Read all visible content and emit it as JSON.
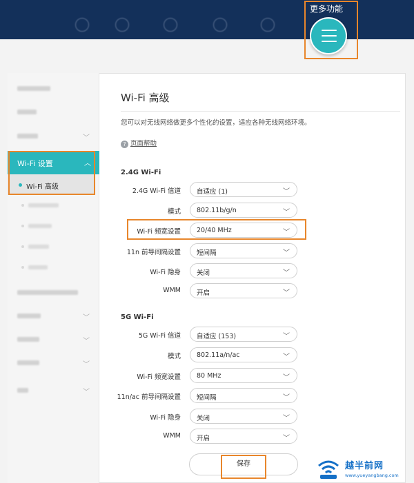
{
  "top_nav": {
    "more_label": "更多功能"
  },
  "sidebar": {
    "active_label": "Wi-Fi 设置",
    "active_sub_label": "Wi-Fi 高级"
  },
  "content": {
    "title": "Wi-Fi 高级",
    "description": "您可以对无线网络做更多个性化的设置，适应各种无线网络环境。",
    "help_link": "页面帮助",
    "section_24": {
      "heading": "2.4G Wi-Fi",
      "rows": [
        {
          "label": "2.4G Wi-Fi 信道",
          "value": "自适应 (1)"
        },
        {
          "label": "模式",
          "value": "802.11b/g/n"
        },
        {
          "label": "Wi-Fi 频宽设置",
          "value": "20/40 MHz"
        },
        {
          "label": "11n 前导间隔设置",
          "value": "短间隔"
        },
        {
          "label": "Wi-Fi 隐身",
          "value": "关闭"
        },
        {
          "label": "WMM",
          "value": "开启"
        }
      ]
    },
    "section_5": {
      "heading": "5G Wi-Fi",
      "rows": [
        {
          "label": "5G Wi-Fi 信道",
          "value": "自适应 (153)"
        },
        {
          "label": "模式",
          "value": "802.11a/n/ac"
        },
        {
          "label": "Wi-Fi 频宽设置",
          "value": "80 MHz"
        },
        {
          "label": "11n/ac 前导间隔设置",
          "value": "短间隔"
        },
        {
          "label": "Wi-Fi 隐身",
          "value": "关闭"
        },
        {
          "label": "WMM",
          "value": "开启"
        }
      ]
    },
    "save_label": "保存"
  },
  "watermark": {
    "name": "越半前网",
    "url": "www.yueyangbang.com"
  },
  "colors": {
    "nav_bg": "#13305a",
    "accent": "#2ab7bd",
    "highlight": "#e8862b"
  }
}
